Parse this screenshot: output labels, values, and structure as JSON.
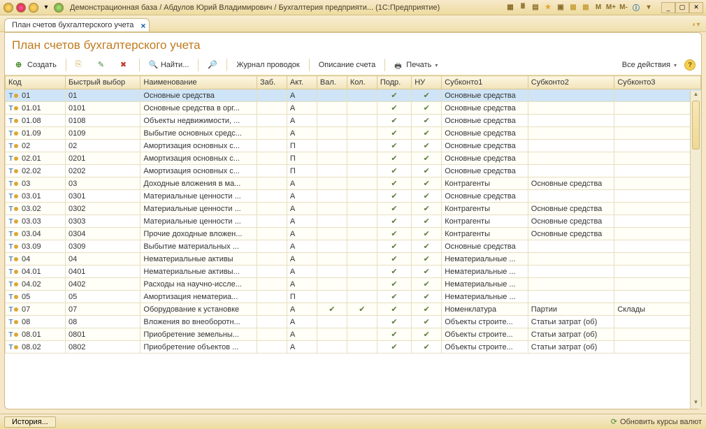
{
  "titlebar": {
    "title": "Демонстрационная база / Абдулов Юрий Владимирович / Бухгалтерия предприяти...   (1С:Предприятие)"
  },
  "tab": {
    "label": "План счетов бухгалтерского учета"
  },
  "page": {
    "title": "План счетов бухгалтерского учета"
  },
  "toolbar": {
    "create": "Создать",
    "find": "Найти...",
    "journal": "Журнал проводок",
    "desc": "Описание счета",
    "print": "Печать",
    "all_actions": "Все действия"
  },
  "columns": {
    "code": "Код",
    "quick": "Быстрый выбор",
    "name": "Наименование",
    "zab": "Заб.",
    "akt": "Акт.",
    "val": "Вал.",
    "kol": "Кол.",
    "podr": "Подр.",
    "nu": "НУ",
    "s1": "Субконто1",
    "s2": "Субконто2",
    "s3": "Субконто3"
  },
  "rows": [
    {
      "code": "01",
      "quick": "01",
      "name": "Основные средства",
      "akt": "А",
      "podr": true,
      "nu": true,
      "s1": "Основные средства",
      "s2": "",
      "s3": "",
      "sel": true
    },
    {
      "code": "01.01",
      "quick": "0101",
      "name": "Основные средства в орг...",
      "akt": "А",
      "podr": true,
      "nu": true,
      "s1": "Основные средства",
      "s2": "",
      "s3": ""
    },
    {
      "code": "01.08",
      "quick": "0108",
      "name": "Объекты недвижимости, ...",
      "akt": "А",
      "podr": true,
      "nu": true,
      "s1": "Основные средства",
      "s2": "",
      "s3": ""
    },
    {
      "code": "01.09",
      "quick": "0109",
      "name": "Выбытие основных средс...",
      "akt": "А",
      "podr": true,
      "nu": true,
      "s1": "Основные средства",
      "s2": "",
      "s3": ""
    },
    {
      "code": "02",
      "quick": "02",
      "name": "Амортизация основных с...",
      "akt": "П",
      "podr": true,
      "nu": true,
      "s1": "Основные средства",
      "s2": "",
      "s3": ""
    },
    {
      "code": "02.01",
      "quick": "0201",
      "name": "Амортизация основных с...",
      "akt": "П",
      "podr": true,
      "nu": true,
      "s1": "Основные средства",
      "s2": "",
      "s3": ""
    },
    {
      "code": "02.02",
      "quick": "0202",
      "name": "Амортизация основных с...",
      "akt": "П",
      "podr": true,
      "nu": true,
      "s1": "Основные средства",
      "s2": "",
      "s3": ""
    },
    {
      "code": "03",
      "quick": "03",
      "name": "Доходные вложения в ма...",
      "akt": "А",
      "podr": true,
      "nu": true,
      "s1": "Контрагенты",
      "s2": "Основные средства",
      "s3": ""
    },
    {
      "code": "03.01",
      "quick": "0301",
      "name": "Материальные ценности ...",
      "akt": "А",
      "podr": true,
      "nu": true,
      "s1": "Основные средства",
      "s2": "",
      "s3": ""
    },
    {
      "code": "03.02",
      "quick": "0302",
      "name": "Материальные ценности ...",
      "akt": "А",
      "podr": true,
      "nu": true,
      "s1": "Контрагенты",
      "s2": "Основные средства",
      "s3": ""
    },
    {
      "code": "03.03",
      "quick": "0303",
      "name": "Материальные ценности ...",
      "akt": "А",
      "podr": true,
      "nu": true,
      "s1": "Контрагенты",
      "s2": "Основные средства",
      "s3": ""
    },
    {
      "code": "03.04",
      "quick": "0304",
      "name": "Прочие доходные вложен...",
      "akt": "А",
      "podr": true,
      "nu": true,
      "s1": "Контрагенты",
      "s2": "Основные средства",
      "s3": ""
    },
    {
      "code": "03.09",
      "quick": "0309",
      "name": "Выбытие материальных ...",
      "akt": "А",
      "podr": true,
      "nu": true,
      "s1": "Основные средства",
      "s2": "",
      "s3": ""
    },
    {
      "code": "04",
      "quick": "04",
      "name": "Нематериальные активы",
      "akt": "А",
      "podr": true,
      "nu": true,
      "s1": "Нематериальные ...",
      "s2": "",
      "s3": ""
    },
    {
      "code": "04.01",
      "quick": "0401",
      "name": "Нематериальные активы...",
      "akt": "А",
      "podr": true,
      "nu": true,
      "s1": "Нематериальные ...",
      "s2": "",
      "s3": ""
    },
    {
      "code": "04.02",
      "quick": "0402",
      "name": "Расходы на научно-иссле...",
      "akt": "А",
      "podr": true,
      "nu": true,
      "s1": "Нематериальные ...",
      "s2": "",
      "s3": ""
    },
    {
      "code": "05",
      "quick": "05",
      "name": "Амортизация нематериа...",
      "akt": "П",
      "podr": true,
      "nu": true,
      "s1": "Нематериальные ...",
      "s2": "",
      "s3": ""
    },
    {
      "code": "07",
      "quick": "07",
      "name": "Оборудование к установке",
      "akt": "А",
      "val": true,
      "kol": true,
      "podr": true,
      "nu": true,
      "s1": "Номенклатура",
      "s2": "Партии",
      "s3": "Склады"
    },
    {
      "code": "08",
      "quick": "08",
      "name": "Вложения во внеоборотн...",
      "akt": "А",
      "podr": true,
      "nu": true,
      "s1": "Объекты строите...",
      "s2": "Статьи затрат (об)",
      "s3": ""
    },
    {
      "code": "08.01",
      "quick": "0801",
      "name": "Приобретение земельны...",
      "akt": "А",
      "podr": true,
      "nu": true,
      "s1": "Объекты строите...",
      "s2": "Статьи затрат (об)",
      "s3": ""
    },
    {
      "code": "08.02",
      "quick": "0802",
      "name": "Приобретение объектов ...",
      "akt": "А",
      "podr": true,
      "nu": true,
      "s1": "Объекты строите...",
      "s2": "Статьи затрат (об)",
      "s3": ""
    }
  ],
  "status": {
    "history": "История...",
    "refresh": "Обновить курсы валют"
  }
}
